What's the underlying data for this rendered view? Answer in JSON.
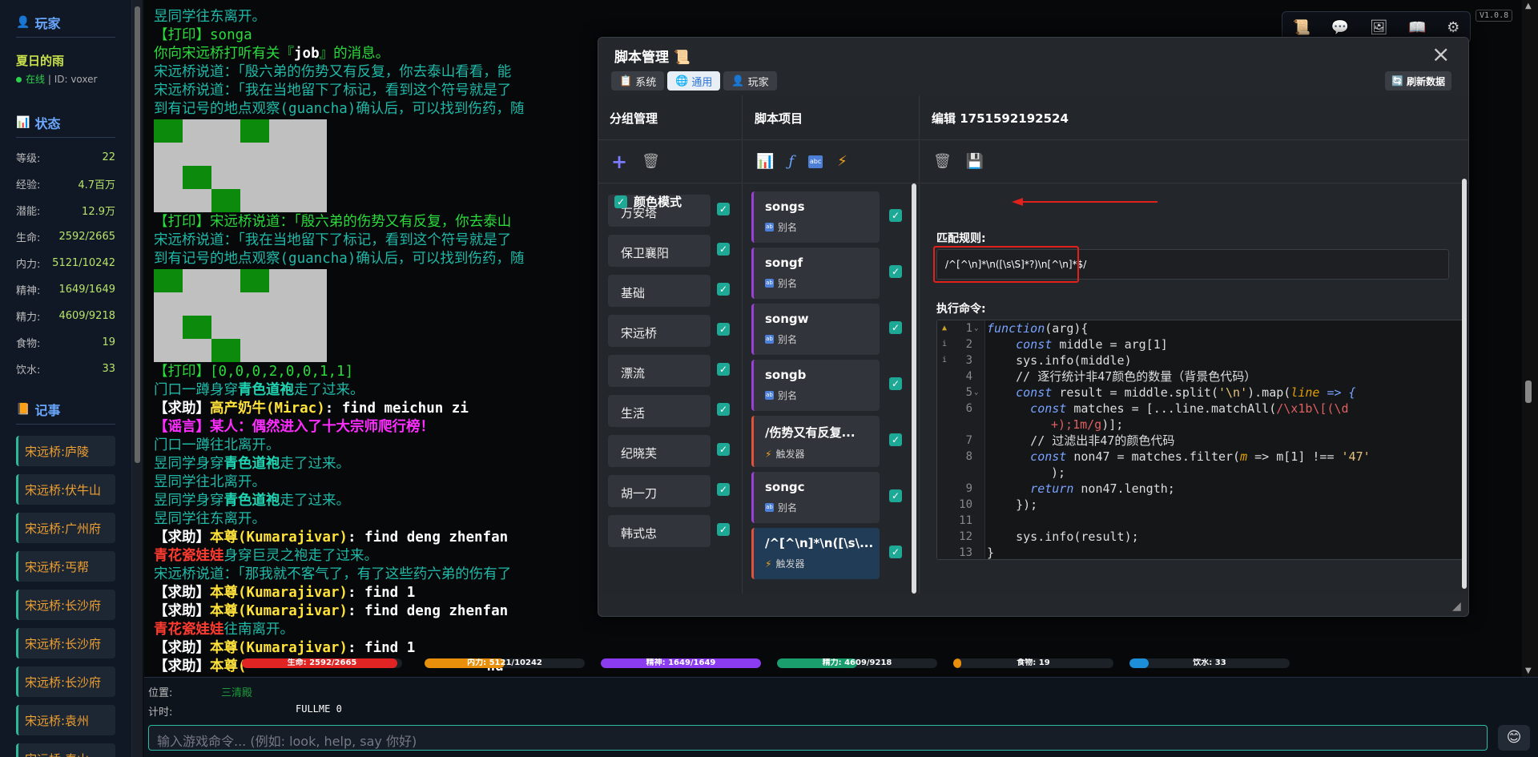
{
  "version": "V1.0.8",
  "sidebar": {
    "player_title": "玩家",
    "player_name": "夏日的雨",
    "status_online": "在线",
    "status_sep": " | ",
    "status_id": "ID: voxer",
    "status_title": "状态",
    "stats": [
      {
        "k": "等级:",
        "v": "22"
      },
      {
        "k": "经验:",
        "v": "4.7百万"
      },
      {
        "k": "潜能:",
        "v": "12.9万"
      },
      {
        "k": "生命:",
        "v": "2592/2665"
      },
      {
        "k": "内力:",
        "v": "5121/10242"
      },
      {
        "k": "精神:",
        "v": "1649/1649"
      },
      {
        "k": "精力:",
        "v": "4609/9218"
      },
      {
        "k": "食物:",
        "v": "19"
      },
      {
        "k": "饮水:",
        "v": "33"
      }
    ],
    "records_title": "记事",
    "records": [
      "宋远桥:庐陵",
      "宋远桥:伏牛山",
      "宋远桥:广州府",
      "宋远桥:丐帮",
      "宋远桥:长沙府",
      "宋远桥:长沙府",
      "宋远桥:长沙府",
      "宋远桥:袁州",
      "宋远桥:泰山"
    ]
  },
  "terminal": {
    "l1": "昱同学往东离开。",
    "l2": "【打印】songa",
    "l3a": "你向宋远桥打听有关『",
    "l3b": "job",
    "l3c": "』的消息。",
    "l4": "宋远桥说道：「殷六弟的伤势又有反复，你去泰山看看，能",
    "l5": "宋远桥说道：「我在当地留下了标记，看到这个符号就是了",
    "l6": "到有记号的地点观察(guancha)确认后，可以找到伤药，随",
    "l7": "【打印】宋远桥说道：「殷六弟的伤势又有反复，你去泰山",
    "l8": "宋远桥说道：「我在当地留下了标记，看到这个符号就是了",
    "l9": "到有记号的地点观察(guancha)确认后，可以找到伤药，随",
    "l10": "【打印】[0,0,0,2,0,0,1,1]",
    "l11a": "门口一蹲身穿",
    "l11b": "青色道袍",
    "l11c": "走了过来。",
    "l12a": "【求助】",
    "l12b": "高产奶牛(Mirac)",
    "l12c": ": find meichun zi",
    "l13": "【谣言】某人：偶然进入了十大宗师爬行榜！",
    "l14": "门口一蹲往北离开。",
    "l15a": "昱同学身穿",
    "l15b": "青色道袍",
    "l15c": "走了过来。",
    "l16": "昱同学往北离开。",
    "l17a": "昱同学身穿",
    "l17b": "青色道袍",
    "l17c": "走了过来。",
    "l18": "昱同学往东离开。",
    "l19a": "【求助】",
    "l19b": "本尊(Kumarajivar)",
    "l19c": ": find deng zhenfan",
    "l20a": "青花瓷娃娃",
    "l20b": "身穿巨灵之袍走了过来。",
    "l21": "宋远桥说道：「那我就不客气了，有了这些药六弟的伤有了",
    "l22a": "【求助】",
    "l22b": "本尊(Kumarajivar)",
    "l22c": ": find 1",
    "l23a": "【求助】",
    "l23b": "本尊(Kumarajivar)",
    "l23c": ": find deng zhenfan",
    "l24a": "青花瓷娃娃",
    "l24b": "往南离开。",
    "l25a": "【求助】",
    "l25b": "本尊(Kumarajivar)",
    "l25c": ": find 1",
    "l26a": "【求助】",
    "l26b": "本尊(",
    "l26c": "nd"
  },
  "bars": [
    {
      "label": "生命: 2592/2665",
      "fill": 0.97,
      "color": "#e02424"
    },
    {
      "label": "内力: 5121/10242",
      "fill": 0.5,
      "color": "#e8900c"
    },
    {
      "label": "精神: 1649/1649",
      "fill": 1.0,
      "color": "#8b3cf0"
    },
    {
      "label": "精力: 4609/9218",
      "fill": 0.5,
      "color": "#1a9e6e"
    },
    {
      "label": "食物: 19",
      "fill": 0.05,
      "color": "#e8900c"
    },
    {
      "label": "饮水: 33",
      "fill": 0.12,
      "color": "#1d8fd8"
    }
  ],
  "bottom": {
    "loc_label": "位置:",
    "loc_value": "三清殿",
    "time_label": "计时:",
    "time_value": "FULLME 0",
    "cmd_placeholder": "输入游戏命令... (例如: look, help, say 你好)"
  },
  "modal": {
    "title": "脚本管理",
    "tabs": [
      "系统",
      "通用",
      "玩家"
    ],
    "refresh": "刷新数据",
    "col1_title": "分组管理",
    "col2_title": "脚本项目",
    "col3_title": "编辑 1751592192524",
    "groups": [
      "万安塔",
      "保卫襄阳",
      "基础",
      "宋远桥",
      "漂流",
      "生活",
      "纪晓芙",
      "胡一刀",
      "韩式忠"
    ],
    "items": [
      {
        "name": "songs",
        "type": "别名"
      },
      {
        "name": "songf",
        "type": "别名"
      },
      {
        "name": "songw",
        "type": "别名"
      },
      {
        "name": "songb",
        "type": "别名"
      },
      {
        "name": "/伤势又有反复...",
        "type": "触发器"
      },
      {
        "name": "songc",
        "type": "别名"
      },
      {
        "name": "/^[^\\n]*\\n([\\s\\...",
        "type": "触发器"
      }
    ],
    "color_mode": "颜色模式",
    "match_label": "匹配规则:",
    "match_value": "/^[^\\n]*\\n([\\s\\S]*?)\\n[^\\n]*$/",
    "exec_label": "执行命令:",
    "code": {
      "c1a": "function",
      "c1b": "(arg){",
      "c2a": "    const ",
      "c2b": "middle = arg[1]",
      "c3": "    sys.info(middle)",
      "c4": "    // 逐行统计非47颜色的数量（背景色代码）",
      "c5a": "    const ",
      "c5b": "result = middle.split(",
      "c5c": "'\\n'",
      "c5d": ").map(",
      "c5e": "line",
      "c5f": " => {",
      "c6a": "      const ",
      "c6b": "matches = [...line.matchAll(",
      "c6c": "/\\x1b\\[(\\d",
      "c6d": "+);1m/g",
      "c6e": ")];",
      "c7": "      // 过滤出非47的颜色代码",
      "c8a": "      const ",
      "c8b": "non47 = matches.filter(",
      "c8c": "m",
      "c8d": " => m[1] !== ",
      "c8e": "'47'",
      "c8f": ");",
      "c9a": "      return ",
      "c9b": "non47.length;",
      "c10": "    });",
      "c11": "",
      "c12": "    sys.info(result);",
      "c13": "}"
    },
    "line_numbers": [
      "1",
      "2",
      "3",
      "4",
      "5",
      "6",
      "",
      "7",
      "8",
      "",
      "9",
      "10",
      "11",
      "12",
      "13"
    ]
  }
}
